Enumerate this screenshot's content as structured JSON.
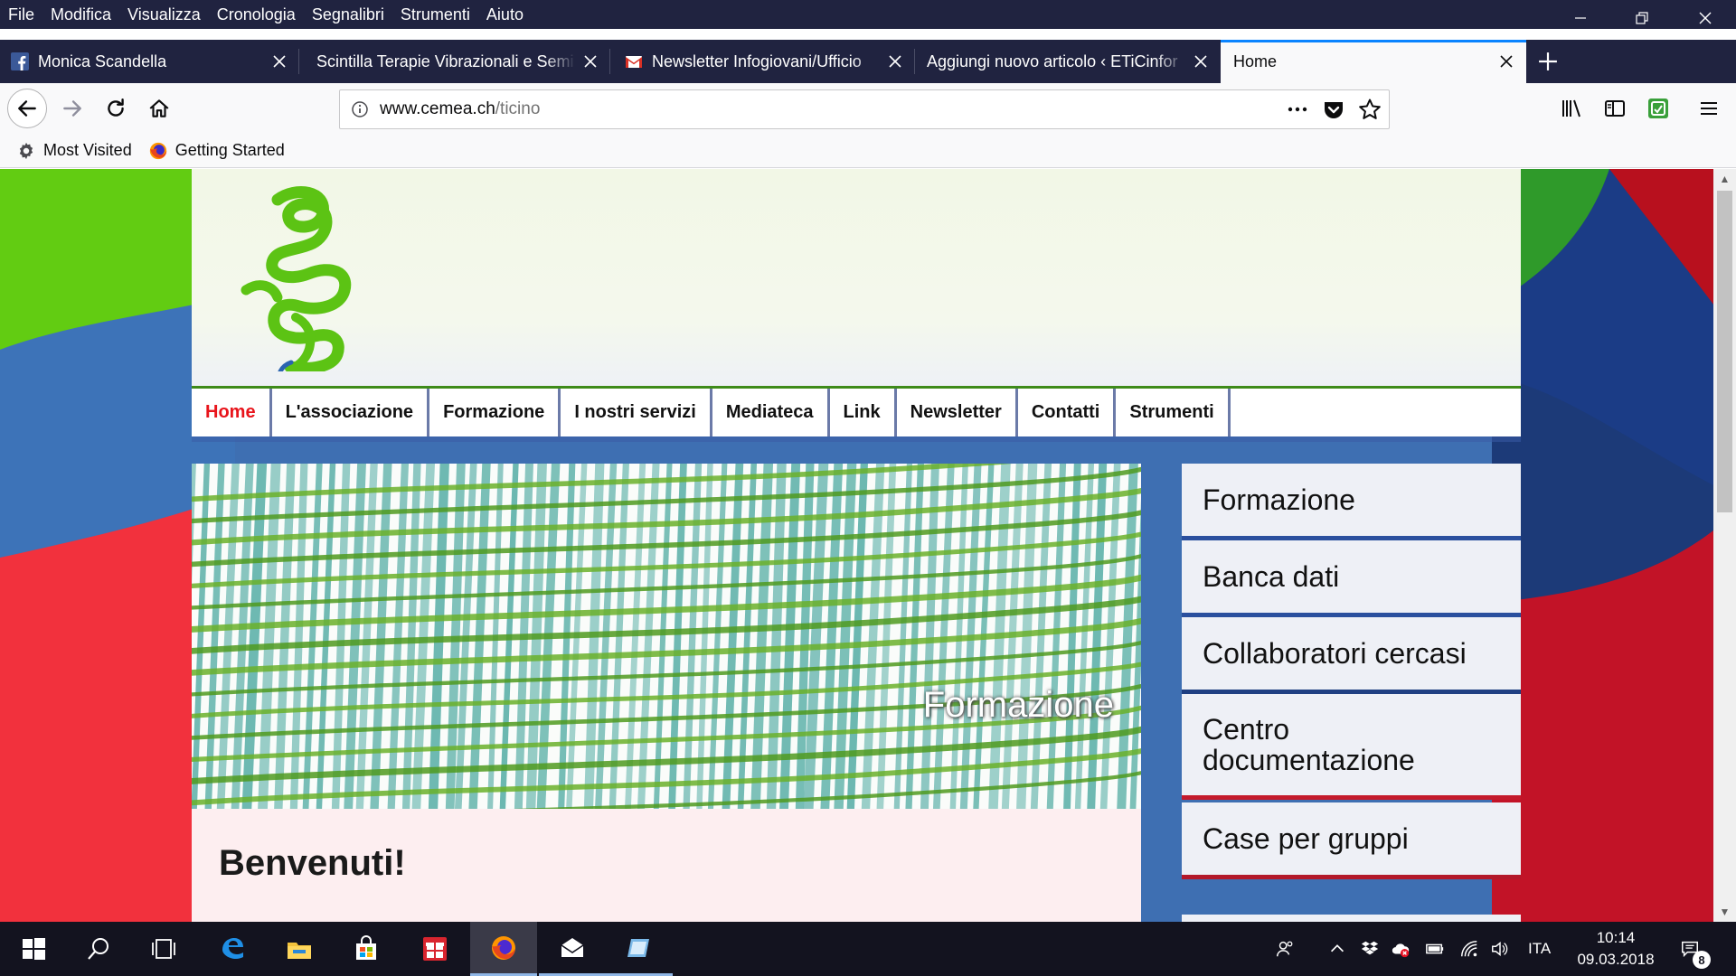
{
  "menubar": {
    "items": [
      "File",
      "Modifica",
      "Visualizza",
      "Cronologia",
      "Segnalibri",
      "Strumenti",
      "Aiuto"
    ]
  },
  "tabs": [
    {
      "title": "Monica Scandella",
      "icon": "facebook-icon"
    },
    {
      "title": "Scintilla Terapie Vibrazionali e Semi",
      "icon": "none"
    },
    {
      "title": "Newsletter Infogiovani/Ufficio",
      "icon": "gmail-icon"
    },
    {
      "title": "Aggiungi nuovo articolo ‹ ETiCinfor",
      "icon": "none"
    },
    {
      "title": "Home",
      "icon": "none",
      "active": true
    }
  ],
  "urlbar": {
    "host": "www.cemea.ch",
    "path": "/ticino"
  },
  "bookmarks": [
    {
      "label": "Most Visited",
      "icon": "gear-icon"
    },
    {
      "label": "Getting Started",
      "icon": "firefox-icon"
    }
  ],
  "site": {
    "nav": [
      "Home",
      "L'associazione",
      "Formazione",
      "I nostri servizi",
      "Mediateca",
      "Link",
      "Newsletter",
      "Contatti",
      "Strumenti"
    ],
    "hero_caption": "Formazione",
    "welcome_title": "Benvenuti!",
    "sidebar": [
      {
        "label": "Formazione",
        "accent": "#2a4f9e"
      },
      {
        "label": "Banca dati",
        "accent": "#2a4f9e"
      },
      {
        "label": "Collaboratori cercasi",
        "accent": "#2a4f9e"
      },
      {
        "label": "Centro documentazione",
        "accent": "#c41a2c"
      },
      {
        "label": "Case per gruppi",
        "accent": "#c41a2c"
      }
    ]
  },
  "taskbar": {
    "clock_time": "10:14",
    "clock_date": "09.03.2018",
    "language": "ITA",
    "notification_count": "8"
  },
  "colors": {
    "browser_dark": "#202340",
    "accent_blue": "#0a84ff",
    "site_green": "#58c615",
    "site_red": "#e8141b"
  }
}
